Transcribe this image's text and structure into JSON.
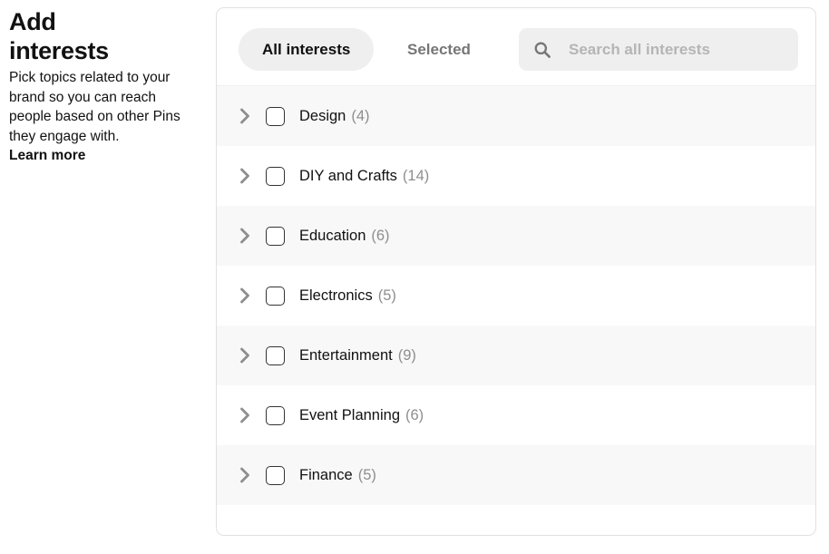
{
  "panel": {
    "title": "Add interests",
    "description": "Pick topics related to your brand so you can reach people based on other Pins they engage with.",
    "learn_more_label": "Learn more"
  },
  "card": {
    "tabs": [
      {
        "label": "All interests",
        "selected": true
      },
      {
        "label": "Selected",
        "selected": false
      }
    ],
    "search": {
      "icon": "search-icon",
      "placeholder": "Search all interests",
      "value": ""
    },
    "interests": [
      {
        "label": "Design",
        "count": "(4)",
        "checked": false,
        "expand_icon": "chevron-right-icon"
      },
      {
        "label": "DIY and Crafts",
        "count": "(14)",
        "checked": false,
        "expand_icon": "chevron-right-icon"
      },
      {
        "label": "Education",
        "count": "(6)",
        "checked": false,
        "expand_icon": "chevron-right-icon"
      },
      {
        "label": "Electronics",
        "count": "(5)",
        "checked": false,
        "expand_icon": "chevron-right-icon"
      },
      {
        "label": "Entertainment",
        "count": "(9)",
        "checked": false,
        "expand_icon": "chevron-right-icon"
      },
      {
        "label": "Event Planning",
        "count": "(6)",
        "checked": false,
        "expand_icon": "chevron-right-icon"
      },
      {
        "label": "Finance",
        "count": "(5)",
        "checked": false,
        "expand_icon": "chevron-right-icon"
      }
    ]
  },
  "colors": {
    "text_primary": "#111111",
    "text_muted": "#767676",
    "count_gray": "#8e8e8e",
    "pill_background": "#efefef",
    "row_stripe": "#f8f8f8",
    "card_border": "#e1e1e1"
  }
}
